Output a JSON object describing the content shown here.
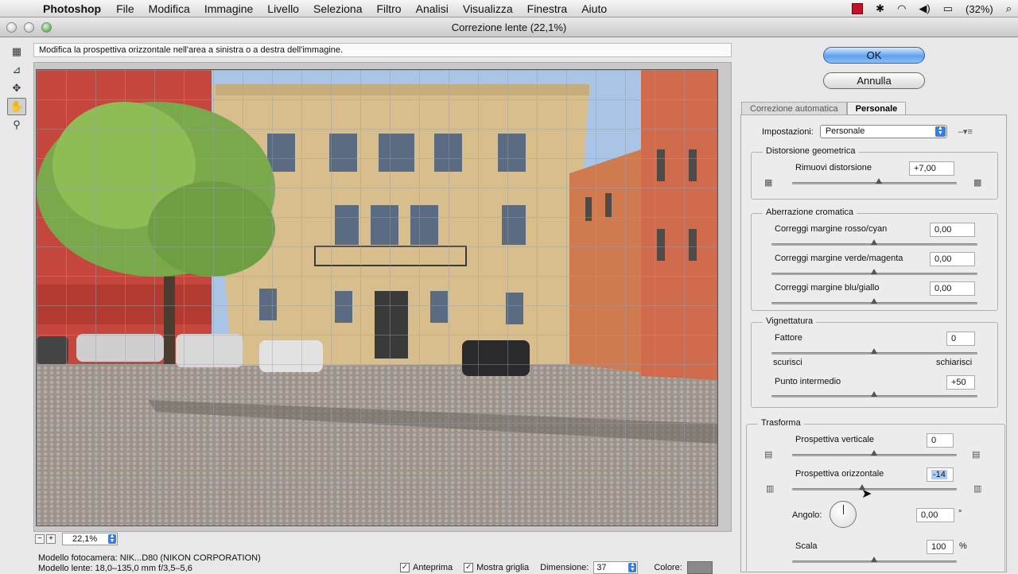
{
  "menubar": {
    "app": "Photoshop",
    "items": [
      "File",
      "Modifica",
      "Immagine",
      "Livello",
      "Seleziona",
      "Filtro",
      "Analisi",
      "Visualizza",
      "Finestra",
      "Aiuto"
    ],
    "battery": "(32%)"
  },
  "window": {
    "title": "Correzione lente (22,1%)"
  },
  "hint": "Modifica la prospettiva orizzontale nell'area a sinistra o a destra dell'immagine.",
  "zoom": {
    "value": "22,1%",
    "minus": "−",
    "plus": "+"
  },
  "info": {
    "camera": "Modello fotocamera: NIK...D80 (NIKON CORPORATION)",
    "lens": "Modello lente: 18,0–135,0 mm f/3,5–5,6"
  },
  "options": {
    "preview_label": "Anteprima",
    "grid_label": "Mostra griglia",
    "size_label": "Dimensione:",
    "size_value": "37",
    "color_label": "Colore:",
    "grid_color": "#8a8a8a"
  },
  "buttons": {
    "ok": "OK",
    "cancel": "Annulla"
  },
  "tabs": {
    "auto": "Correzione automatica",
    "custom": "Personale"
  },
  "settings": {
    "label": "Impostazioni:",
    "value": "Personale"
  },
  "distortion": {
    "title": "Distorsione geometrica",
    "remove_label": "Rimuovi distorsione",
    "remove_value": "+7,00"
  },
  "chromatic": {
    "title": "Aberrazione cromatica",
    "red_cyan_label": "Correggi margine rosso/cyan",
    "red_cyan_value": "0,00",
    "green_magenta_label": "Correggi margine verde/magenta",
    "green_magenta_value": "0,00",
    "blue_yellow_label": "Correggi margine blu/giallo",
    "blue_yellow_value": "0,00"
  },
  "vignette": {
    "title": "Vignettatura",
    "amount_label": "Fattore",
    "amount_value": "0",
    "darken": "scurisci",
    "lighten": "schiarisci",
    "midpoint_label": "Punto intermedio",
    "midpoint_value": "+50"
  },
  "transform": {
    "title": "Trasforma",
    "vertical_label": "Prospettiva verticale",
    "vertical_value": "0",
    "horizontal_label": "Prospettiva orizzontale",
    "horizontal_value": "-14",
    "angle_label": "Angolo:",
    "angle_value": "0,00",
    "angle_unit": "°",
    "scale_label": "Scala",
    "scale_value": "100",
    "scale_unit": "%"
  }
}
